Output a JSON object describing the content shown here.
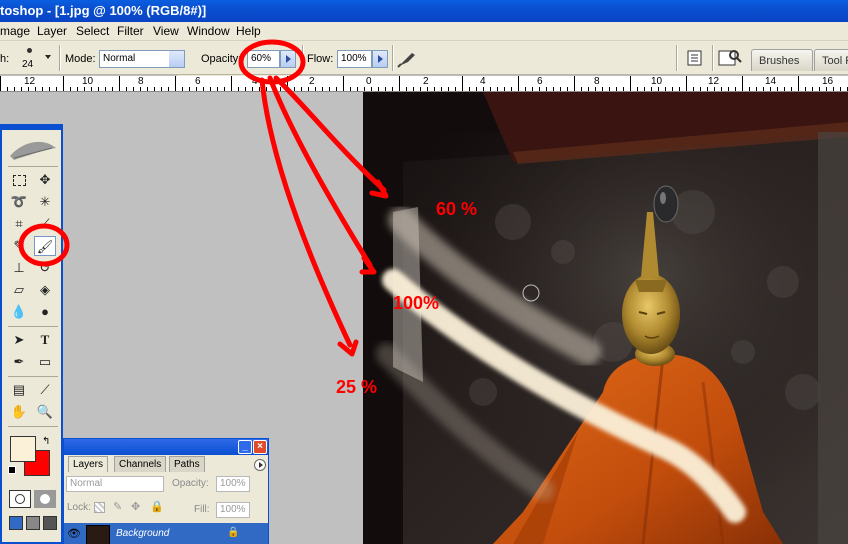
{
  "window": {
    "title": "toshop - [1.jpg @ 100% (RGB/8#)]"
  },
  "menu": [
    "mage",
    "Layer",
    "Select",
    "Filter",
    "View",
    "Window",
    "Help"
  ],
  "options": {
    "brush_prefix": "h:",
    "brush_size": "24",
    "mode_label": "Mode:",
    "mode_value": "Normal",
    "opacity_label": "Opacity:",
    "opacity_value": "60%",
    "flow_label": "Flow:",
    "flow_value": "100%",
    "palette_tabs": [
      "Brushes",
      "Tool P"
    ]
  },
  "ruler": {
    "labels": [
      "12",
      "10",
      "8",
      "6",
      "4",
      "2",
      "0",
      "2",
      "4",
      "6",
      "8",
      "10",
      "12",
      "14",
      "16"
    ]
  },
  "layers_palette": {
    "tabs": [
      "Layers",
      "Channels",
      "Paths"
    ],
    "blend_mode": "Normal",
    "opacity_label": "Opacity:",
    "opacity_value": "100%",
    "lock_label": "Lock:",
    "fill_label": "Fill:",
    "fill_value": "100%",
    "layer_name": "Background"
  },
  "annotations": {
    "opacity_60": "60 %",
    "opacity_100": "100%",
    "opacity_25": "25 %"
  },
  "colors": {
    "foreground": "#fbf0d8",
    "background": "#ff0000",
    "annotation": "#ff0000",
    "titlebar": "#0a4fd0",
    "robe": "#d95a10"
  }
}
